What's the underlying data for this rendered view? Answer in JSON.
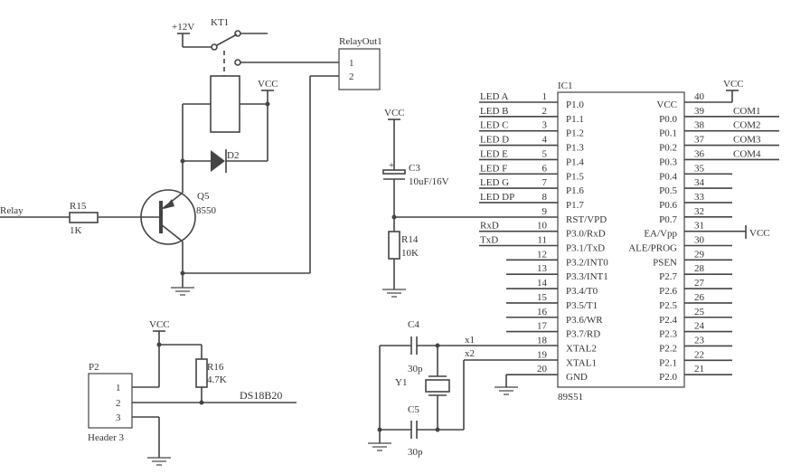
{
  "relay": {
    "input_label": "Relay",
    "r15": {
      "ref": "R15",
      "value": "1K"
    },
    "q5": {
      "ref": "Q5",
      "value": "8550"
    },
    "d2": {
      "ref": "D2"
    },
    "kt1": {
      "ref": "KT1",
      "supply": "+12V"
    },
    "vcc": "VCC",
    "connector": {
      "ref": "RelayOut1",
      "pins": [
        "1",
        "2"
      ]
    }
  },
  "reset": {
    "vcc": "VCC",
    "c3": {
      "ref": "C3",
      "value": "10uF/16V"
    },
    "r14": {
      "ref": "R14",
      "value": "10K"
    }
  },
  "sensor": {
    "vcc": "VCC",
    "header": {
      "ref": "P2",
      "name": "Header 3",
      "pins": [
        "1",
        "2",
        "3"
      ]
    },
    "r16": {
      "ref": "R16",
      "value": "4.7K"
    },
    "net": "DS18B20"
  },
  "crystal": {
    "c4": {
      "ref": "C4",
      "value": "30p"
    },
    "c5": {
      "ref": "C5",
      "value": "30p"
    },
    "y1": {
      "ref": "Y1"
    },
    "nets": [
      "x1",
      "x2"
    ]
  },
  "ic": {
    "ref": "IC1",
    "part": "89S51",
    "vcc_top": "VCC",
    "vcc_ea": "VCC",
    "left_pins": [
      {
        "num": "1",
        "name": "P1.0",
        "net": "LED A"
      },
      {
        "num": "2",
        "name": "P1.1",
        "net": "LED B"
      },
      {
        "num": "3",
        "name": "P1.2",
        "net": "LED C"
      },
      {
        "num": "4",
        "name": "P1.3",
        "net": "LED D"
      },
      {
        "num": "5",
        "name": "P1.4",
        "net": "LED E"
      },
      {
        "num": "6",
        "name": "P1.5",
        "net": "LED F"
      },
      {
        "num": "7",
        "name": "P1.6",
        "net": "LED G"
      },
      {
        "num": "8",
        "name": "P1.7",
        "net": "LED DP"
      },
      {
        "num": "9",
        "name": "RST/VPD",
        "net": ""
      },
      {
        "num": "10",
        "name": "P3.0/RxD",
        "net": "RxD"
      },
      {
        "num": "11",
        "name": "P3.1/TxD",
        "net": "TxD"
      },
      {
        "num": "12",
        "name": "P3.2/INT0",
        "net": ""
      },
      {
        "num": "13",
        "name": "P3.3/INT1",
        "net": ""
      },
      {
        "num": "14",
        "name": "P3.4/T0",
        "net": ""
      },
      {
        "num": "15",
        "name": "P3.5/T1",
        "net": ""
      },
      {
        "num": "16",
        "name": "P3.6/WR",
        "net": ""
      },
      {
        "num": "17",
        "name": "P3.7/RD",
        "net": ""
      },
      {
        "num": "18",
        "name": "XTAL2",
        "net": ""
      },
      {
        "num": "19",
        "name": "XTAL1",
        "net": ""
      },
      {
        "num": "20",
        "name": "GND",
        "net": ""
      }
    ],
    "right_pins": [
      {
        "num": "40",
        "name": "VCC",
        "net": ""
      },
      {
        "num": "39",
        "name": "P0.0",
        "net": "COM1"
      },
      {
        "num": "38",
        "name": "P0.1",
        "net": "COM2"
      },
      {
        "num": "37",
        "name": "P0.2",
        "net": "COM3"
      },
      {
        "num": "36",
        "name": "P0.3",
        "net": "COM4"
      },
      {
        "num": "35",
        "name": "P0.4",
        "net": ""
      },
      {
        "num": "34",
        "name": "P0.5",
        "net": ""
      },
      {
        "num": "33",
        "name": "P0.6",
        "net": ""
      },
      {
        "num": "32",
        "name": "P0.7",
        "net": ""
      },
      {
        "num": "31",
        "name": "EA/Vpp",
        "net": ""
      },
      {
        "num": "30",
        "name": "ALE/PROG",
        "net": ""
      },
      {
        "num": "29",
        "name": "PSEN",
        "net": ""
      },
      {
        "num": "28",
        "name": "P2.7",
        "net": ""
      },
      {
        "num": "27",
        "name": "P2.6",
        "net": ""
      },
      {
        "num": "26",
        "name": "P2.5",
        "net": ""
      },
      {
        "num": "25",
        "name": "P2.4",
        "net": ""
      },
      {
        "num": "24",
        "name": "P2.3",
        "net": ""
      },
      {
        "num": "23",
        "name": "P2.2",
        "net": ""
      },
      {
        "num": "22",
        "name": "P2.1",
        "net": ""
      },
      {
        "num": "21",
        "name": "P2.0",
        "net": ""
      }
    ]
  }
}
